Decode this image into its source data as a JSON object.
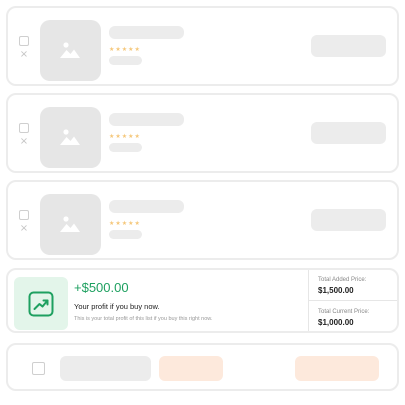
{
  "items": [
    {
      "stars": "★★★★★"
    },
    {
      "stars": "★★★★★"
    },
    {
      "stars": "★★★★★"
    }
  ],
  "icons": {
    "remove": "×",
    "image_placeholder": "image-icon",
    "trend": "trending-up-icon"
  },
  "profit": {
    "amount": "+$500.00",
    "title": "Your profit if you buy now.",
    "description": "This is your total profit of this list if you buy this right now."
  },
  "prices": {
    "total_added_label": "Total Added Price:",
    "total_added_value": "$1,500.00",
    "total_current_label": "Total Current Price:",
    "total_current_value": "$1,000.00"
  },
  "colors": {
    "accent_green": "#1ea060",
    "icon_bg": "#e3f5ea",
    "star": "#f5c77a",
    "peach": "#fde9dc",
    "skeleton": "#ececec"
  }
}
